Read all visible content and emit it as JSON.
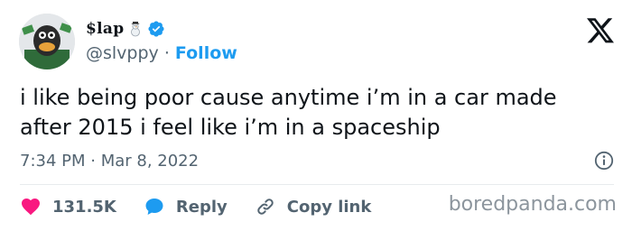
{
  "author": {
    "display_name": "$lap",
    "handle": "@slvppy",
    "separator": " · ",
    "follow_label": "Follow"
  },
  "tweet": {
    "text": "i like being poor cause anytime i’m in a car made\nafter 2015 i feel like i’m in a spaceship",
    "time": "7:34 PM",
    "date": "Mar 8, 2022",
    "meta_separator": " · "
  },
  "actions": {
    "like_count": "131.5K",
    "reply_label": "Reply",
    "copy_link_label": "Copy link"
  },
  "watermark": "boredpanda.com",
  "colors": {
    "accent": "#1d9bf0",
    "like": "#f91880",
    "text": "#0f1419",
    "secondary": "#536471"
  },
  "icons": {
    "emoji": "snowman-icon",
    "verified": "verified-badge-icon",
    "platform": "x-logo-icon",
    "info": "info-icon",
    "like": "heart-icon",
    "reply": "speech-bubble-icon",
    "copy_link": "link-icon"
  }
}
